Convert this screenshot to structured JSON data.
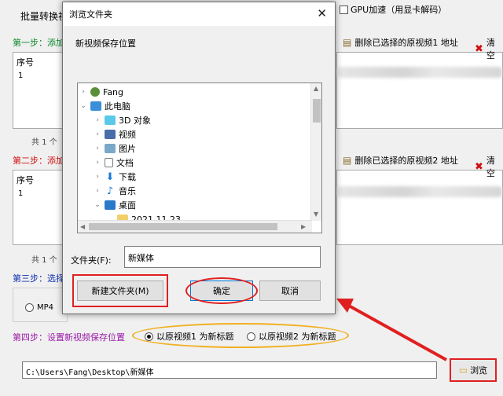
{
  "app": {
    "title": "批量转换视",
    "gpu_label": "GPU加速（用显卡解码）",
    "step1": "第一步：添加",
    "step2": "第二步：添加",
    "step3": "第三步：选择",
    "step4": "第四步：设置新视频保存位置",
    "col_header": "序号",
    "row_index": "1",
    "count1": "共 1 个",
    "count2": "共 1 个",
    "delete1": "删除已选择的原视频1 地址",
    "delete2": "删除已选择的原视频2 地址",
    "clear1": "清空",
    "clear2": "清空",
    "format_option": "MP4",
    "radio_title1": "以原视频1 为新标题",
    "radio_title2": "以原视频2 为新标题",
    "save_path": "C:\\Users\\Fang\\Desktop\\新媒体",
    "browse_label": "浏览"
  },
  "dialog": {
    "title": "浏览文件夹",
    "close_glyph": "✕",
    "description": "新视频保存位置",
    "tree": [
      {
        "label": "Fang",
        "icon": "user-icon",
        "depth": 0,
        "expanded": false
      },
      {
        "label": "此电脑",
        "icon": "computer-icon",
        "depth": 0,
        "expanded": true
      },
      {
        "label": "3D 对象",
        "icon": "3d-objects-icon",
        "depth": 1,
        "expanded": false
      },
      {
        "label": "视频",
        "icon": "videos-icon",
        "depth": 1,
        "expanded": false
      },
      {
        "label": "图片",
        "icon": "pictures-icon",
        "depth": 1,
        "expanded": false
      },
      {
        "label": "文档",
        "icon": "documents-icon",
        "depth": 1,
        "expanded": false
      },
      {
        "label": "下载",
        "icon": "downloads-icon",
        "depth": 1,
        "expanded": false
      },
      {
        "label": "音乐",
        "icon": "music-icon",
        "depth": 1,
        "expanded": false
      },
      {
        "label": "桌面",
        "icon": "desktop-icon",
        "depth": 1,
        "expanded": true
      },
      {
        "label": "2021.11.23",
        "icon": "folder-icon",
        "depth": 2,
        "expanded": false
      }
    ],
    "folder_label": "文件夹(F):",
    "folder_value": "新媒体",
    "new_folder_label": "新建文件夹(M)",
    "ok_label": "确定",
    "cancel_label": "取消"
  },
  "colors": {
    "highlight_red": "#e02020",
    "highlight_orange": "#f0b020",
    "step_green": "#0a8a2a",
    "step_red": "#d01010",
    "step_blue": "#1030b0",
    "step_purple": "#9a1aa8"
  }
}
